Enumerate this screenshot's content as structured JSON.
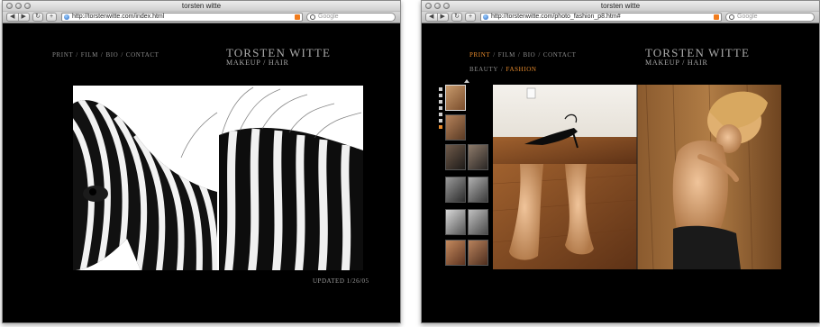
{
  "windows": [
    {
      "title": "torsten witte",
      "url": "http://torstenwitte.com/index.html",
      "search_placeholder": "Google",
      "nav": [
        "PRINT",
        "FILM",
        "BIO",
        "CONTACT"
      ],
      "brand_name": "TORSTEN WITTE",
      "brand_sub": "MAKEUP / HAIR",
      "updated": "UPDATED 1/26/05"
    },
    {
      "title": "torsten witte",
      "url": "http://torstenwitte.com/photo_fashion_p8.htm#",
      "search_placeholder": "Google",
      "nav": [
        "PRINT",
        "FILM",
        "BIO",
        "CONTACT"
      ],
      "nav_active": "PRINT",
      "subnav": [
        "BEAUTY",
        "FASHION"
      ],
      "subnav_active": "FASHION",
      "brand_name": "TORSTEN WITTE",
      "brand_sub": "MAKEUP / HAIR"
    }
  ],
  "toolbar_glyphs": {
    "back": "◀",
    "forward": "▶",
    "reload": "↻",
    "add": "+"
  },
  "icons": [
    "globe-icon",
    "rss-icon",
    "search-icon",
    "back-icon",
    "forward-icon",
    "reload-icon",
    "add-bookmark-icon"
  ],
  "colors": {
    "accent": "#e88b2c",
    "nav_gray": "#8b8b8b",
    "brand_gray": "#aaaaaa",
    "page_bg": "#000000"
  },
  "thumbnail_count": 10,
  "page_indicator_count": 7,
  "page_indicator_active_index": 6
}
